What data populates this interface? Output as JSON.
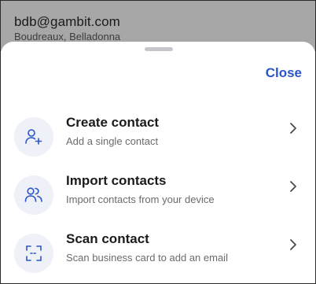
{
  "background": {
    "email": "bdb@gambit.com",
    "name": "Boudreaux, Belladonna"
  },
  "sheet": {
    "close_label": "Close",
    "items": [
      {
        "title": "Create contact",
        "subtitle": "Add a single contact",
        "icon": "add-person-icon"
      },
      {
        "title": "Import contacts",
        "subtitle": "Import contacts from your device",
        "icon": "import-people-icon"
      },
      {
        "title": "Scan contact",
        "subtitle": "Scan business card to add an email",
        "icon": "scan-frame-icon"
      }
    ]
  },
  "colors": {
    "accent": "#2b55c8",
    "icon_bg": "#eef1f8",
    "backdrop": "#a7a7a7"
  }
}
